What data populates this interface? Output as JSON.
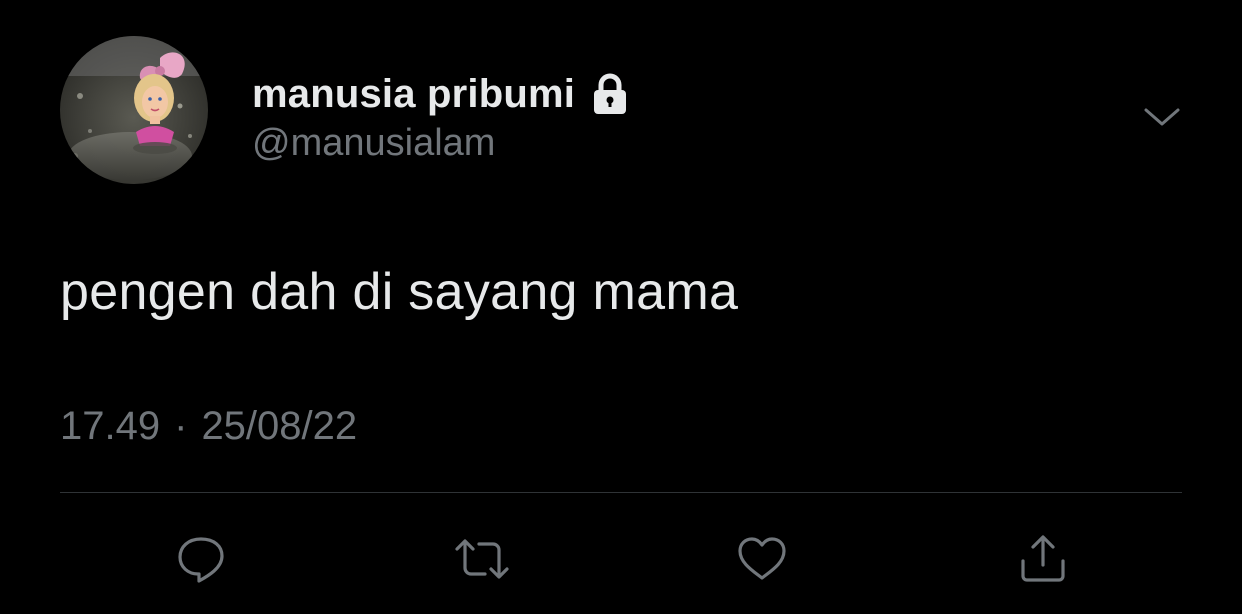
{
  "tweet": {
    "display_name": "manusia pribumi",
    "handle": "@manusialam",
    "text": "pengen dah di sayang mama",
    "time": "17.49",
    "separator": "·",
    "date": "25/08/22",
    "protected_icon": "lock-icon",
    "menu_icon": "chevron-down-icon"
  },
  "actions": [
    {
      "icon": "reply-icon"
    },
    {
      "icon": "retweet-icon"
    },
    {
      "icon": "like-icon"
    },
    {
      "icon": "share-icon"
    }
  ],
  "colors": {
    "background": "#000000",
    "primary_text": "#e7e9ea",
    "secondary_text": "#71767b",
    "divider": "#2f3336"
  }
}
